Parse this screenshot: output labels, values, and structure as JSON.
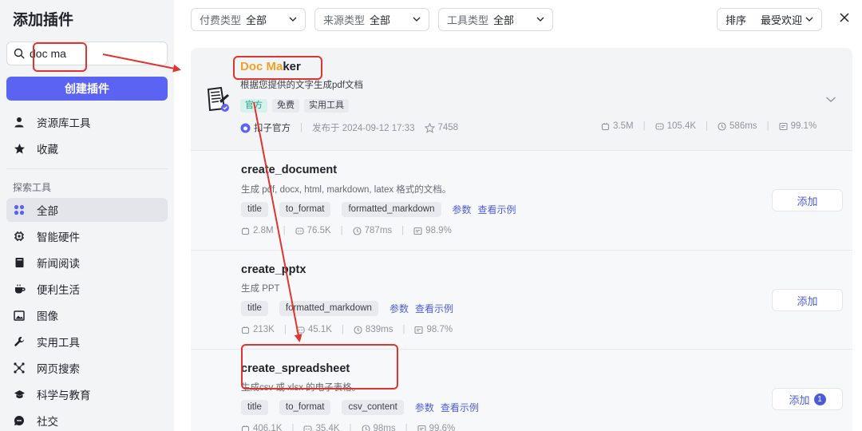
{
  "sidebar": {
    "title": "添加插件",
    "search": {
      "value": "doc ma",
      "placeholder": ""
    },
    "create_button": "创建插件",
    "top_items": [
      {
        "label": "资源库工具",
        "icon": "user-icon"
      },
      {
        "label": "收藏",
        "icon": "star-icon"
      }
    ],
    "section_label": "探索工具",
    "items": [
      {
        "label": "全部",
        "icon": "grid-icon",
        "active": true
      },
      {
        "label": "智能硬件",
        "icon": "chip-icon"
      },
      {
        "label": "新闻阅读",
        "icon": "book-icon"
      },
      {
        "label": "便利生活",
        "icon": "cup-icon"
      },
      {
        "label": "图像",
        "icon": "image-icon"
      },
      {
        "label": "实用工具",
        "icon": "wrench-icon"
      },
      {
        "label": "网页搜索",
        "icon": "web-icon"
      },
      {
        "label": "科学与教育",
        "icon": "graduation-icon"
      },
      {
        "label": "社交",
        "icon": "chat-icon"
      }
    ]
  },
  "filters": {
    "pay": {
      "label": "付费类型",
      "value": "全部"
    },
    "source": {
      "label": "来源类型",
      "value": "全部"
    },
    "tool": {
      "label": "工具类型",
      "value": "全部"
    },
    "sort": {
      "label": "排序",
      "value": "最受欢迎"
    }
  },
  "plugin": {
    "name_highlight": "Doc Ma",
    "name_rest": "ker",
    "description": "根据您提供的文字生成pdf文档",
    "tags": [
      "官方",
      "免费",
      "实用工具"
    ],
    "author": "扣子官方",
    "published": "发布于 2024-09-12 17:33",
    "favorites": "7458",
    "stats": {
      "calls": "3.5M",
      "users": "105.4K",
      "latency": "586ms",
      "success": "99.1%"
    }
  },
  "tools": [
    {
      "name": "create_document",
      "description": "生成 pdf, docx, html, markdown, latex 格式的文档。",
      "params": [
        "title",
        "to_format",
        "formatted_markdown"
      ],
      "stats": {
        "calls": "2.8M",
        "users": "76.5K",
        "latency": "787ms",
        "success": "98.9%"
      },
      "add_label": "添加",
      "badge": ""
    },
    {
      "name": "create_pptx",
      "description": "生成 PPT",
      "params": [
        "title",
        "formatted_markdown"
      ],
      "stats": {
        "calls": "213K",
        "users": "45.1K",
        "latency": "839ms",
        "success": "98.7%"
      },
      "add_label": "添加",
      "badge": ""
    },
    {
      "name": "create_spreadsheet",
      "description": "生成csv 或 xlsx 的电子表格。",
      "params": [
        "title",
        "to_format",
        "csv_content"
      ],
      "stats": {
        "calls": "406.1K",
        "users": "35.4K",
        "latency": "98ms",
        "success": "99.6%"
      },
      "add_label": "添加",
      "badge": "1"
    }
  ],
  "links": {
    "params": "参数",
    "examples": "查看示例"
  },
  "colors": {
    "accent": "#5b63f2",
    "link": "#4e5bd8",
    "highlight": "#f0a12b",
    "annotation": "#e0352f",
    "official_tag": "#1a9e7e"
  }
}
